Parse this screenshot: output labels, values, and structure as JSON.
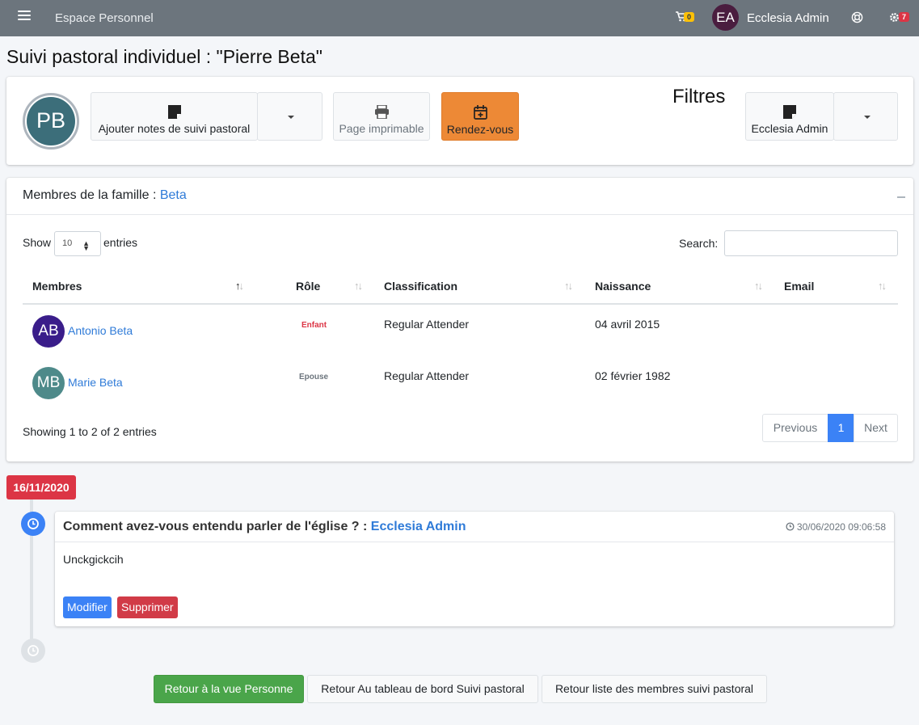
{
  "navbar": {
    "brand": "Espace Personnel",
    "cart_count": "0",
    "avatar_initials": "EA",
    "user_name": "Ecclesia Admin",
    "settings_count": "7"
  },
  "page": {
    "title": "Suivi pastoral individuel : \"Pierre Beta\""
  },
  "actions": {
    "avatar_initials": "PB",
    "add_notes_label": "Ajouter notes de suivi pastoral",
    "print_label": "Page imprimable",
    "rdv_label": "Rendez-vous",
    "filters_title": "Filtres",
    "filter_user_label": "Ecclesia Admin"
  },
  "family": {
    "header_prefix": "Membres de la famille : ",
    "family_name": "Beta",
    "show_label": "Show",
    "entries_select_value": "10",
    "entries_label": "entries",
    "search_label": "Search:",
    "columns": [
      "Membres",
      "Rôle",
      "Classification",
      "Naissance",
      "Email"
    ],
    "rows": [
      {
        "initials": "AB",
        "name": "Antonio Beta",
        "role": "Enfant",
        "classification": "Regular Attender",
        "birth": "04 avril 2015",
        "email": ""
      },
      {
        "initials": "MB",
        "name": "Marie Beta",
        "role": "Epouse",
        "classification": "Regular Attender",
        "birth": "02 février 1982",
        "email": ""
      }
    ],
    "showing_text": "Showing 1 to 2 of 2 entries",
    "pagination": {
      "previous": "Previous",
      "current": "1",
      "next": "Next"
    }
  },
  "timeline": {
    "date": "16/11/2020",
    "item": {
      "title": "Comment avez-vous entendu parler de l'église ? : ",
      "author": "Ecclesia Admin",
      "time": "30/06/2020 09:06:58",
      "body": "Unckgickcih",
      "edit_label": "Modifier",
      "delete_label": "Supprimer"
    }
  },
  "footer": {
    "back_person": "Retour à la vue Personne",
    "back_dashboard": "Retour Au tableau de bord Suivi pastoral",
    "back_list": "Retour liste des membres suivi pastoral"
  },
  "colors": {
    "navbar": "#6c757d",
    "accent_orange": "#ed8936",
    "link_blue": "#2f7bd8",
    "danger": "#dc3545",
    "success": "#4aa54a",
    "primary": "#3b82f6"
  }
}
